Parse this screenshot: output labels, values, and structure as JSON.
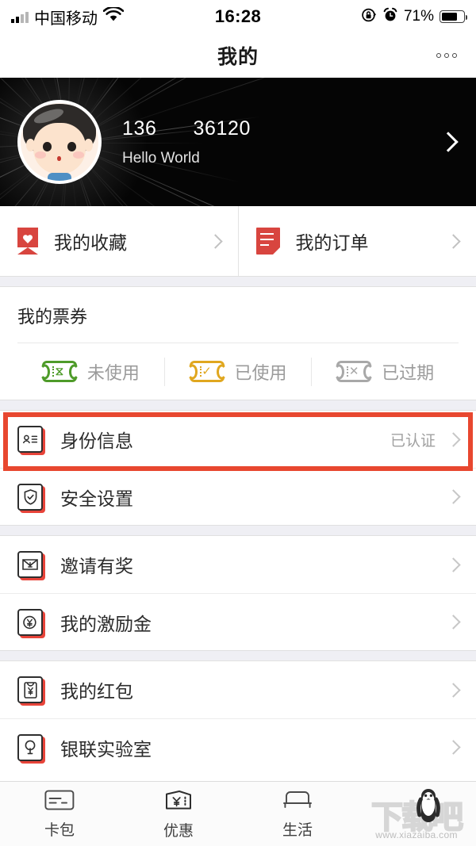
{
  "status_bar": {
    "carrier": "中国移动",
    "time": "16:28",
    "battery_percent": "71%",
    "battery_level": 71,
    "icons": [
      "signal-bars-icon",
      "wifi-icon",
      "rotation-lock-icon",
      "alarm-clock-icon",
      "battery-icon"
    ]
  },
  "nav": {
    "title": "我的",
    "more_icon": "more-dots-icon"
  },
  "profile": {
    "phone": "136",
    "phone_suffix": "36120",
    "nickname": "Hello World",
    "avatar_icon": "avatar-boy-icon",
    "chevron_icon": "chevron-right-icon"
  },
  "quick_actions": [
    {
      "label": "我的收藏",
      "icon": "bookmark-heart-icon"
    },
    {
      "label": "我的订单",
      "icon": "order-document-icon"
    }
  ],
  "tickets": {
    "title": "我的票券",
    "items": [
      {
        "label": "未使用",
        "icon": "ticket-unused-icon",
        "glyph": "⧖",
        "color": "#4e9b29"
      },
      {
        "label": "已使用",
        "icon": "ticket-used-icon",
        "glyph": "✓",
        "color": "#e0a71f"
      },
      {
        "label": "已过期",
        "icon": "ticket-expired-icon",
        "glyph": "✕",
        "color": "#a8a8a8"
      }
    ]
  },
  "menu_groups": [
    {
      "rows": [
        {
          "label": "身份信息",
          "value": "已认证",
          "icon": "id-card-icon",
          "highlighted": true
        },
        {
          "label": "安全设置",
          "value": "",
          "icon": "shield-check-icon",
          "highlighted": false
        }
      ]
    },
    {
      "rows": [
        {
          "label": "邀请有奖",
          "value": "",
          "icon": "invite-envelope-icon",
          "highlighted": false
        },
        {
          "label": "我的激励金",
          "value": "",
          "icon": "reward-coin-icon",
          "highlighted": false
        }
      ]
    },
    {
      "rows": [
        {
          "label": "我的红包",
          "value": "",
          "icon": "red-packet-icon",
          "highlighted": false
        },
        {
          "label": "银联实验室",
          "value": "",
          "icon": "lab-bulb-icon",
          "highlighted": false
        }
      ]
    }
  ],
  "tab_bar": {
    "tabs": [
      {
        "label": "卡包",
        "icon": "card-icon"
      },
      {
        "label": "优惠",
        "icon": "coupon-icon"
      },
      {
        "label": "生活",
        "icon": "sofa-icon"
      }
    ]
  },
  "watermark": {
    "text": "下载吧",
    "url": "www.xiazaiba.com",
    "icon": "penguin-mascot-icon"
  },
  "colors": {
    "accent_red": "#d8453f",
    "highlight": "#e8472f",
    "ticket_green": "#4e9b29",
    "ticket_yellow": "#e0a71f",
    "ticket_gray": "#a8a8a8",
    "page_bg": "#efeff4"
  }
}
